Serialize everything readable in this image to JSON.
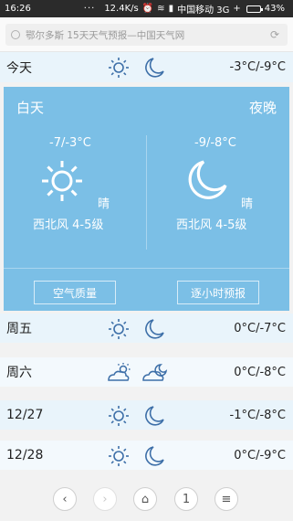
{
  "status_bar": {
    "time": "16:26",
    "dots": "···",
    "net_speed": "12.4K/s",
    "carrier": "中国移动 3G",
    "battery": "43%",
    "battery_level": 0.43
  },
  "browser": {
    "page_title": "鄂尔多斯 15天天气预报—中国天气网"
  },
  "today": {
    "label": "今天",
    "temp": "-3°C/-9°C",
    "day_icon": "sun-icon",
    "night_icon": "moon-icon"
  },
  "detail": {
    "day_label": "白天",
    "night_label": "夜晚",
    "day_temp": "-7/-3°C",
    "night_temp": "-9/-8°C",
    "day_cond": "晴",
    "night_cond": "晴",
    "day_wind": "西北风 4-5级",
    "night_wind": "西北风 4-5级",
    "air_quality_button": "空气质量",
    "hourly_button": "逐小时预报"
  },
  "forecast": [
    {
      "day": "周五",
      "temp": "0°C/-7°C",
      "day_icon": "sun-icon",
      "night_icon": "moon-icon"
    },
    {
      "day": "周六",
      "temp": "0°C/-8°C",
      "day_icon": "partly-cloudy-sun-icon",
      "night_icon": "partly-cloudy-moon-icon"
    },
    {
      "day": "12/27",
      "temp": "-1°C/-8°C",
      "day_icon": "sun-icon",
      "night_icon": "moon-icon"
    },
    {
      "day": "12/28",
      "temp": "0°C/-9°C",
      "day_icon": "sun-icon",
      "night_icon": "moon-icon"
    }
  ],
  "bottom_nav": {
    "tab_count": "1"
  },
  "colors": {
    "panel": "#7bbfe6",
    "icon_stroke": "#3d6fa8",
    "row_bg": "#e9f4fb"
  }
}
